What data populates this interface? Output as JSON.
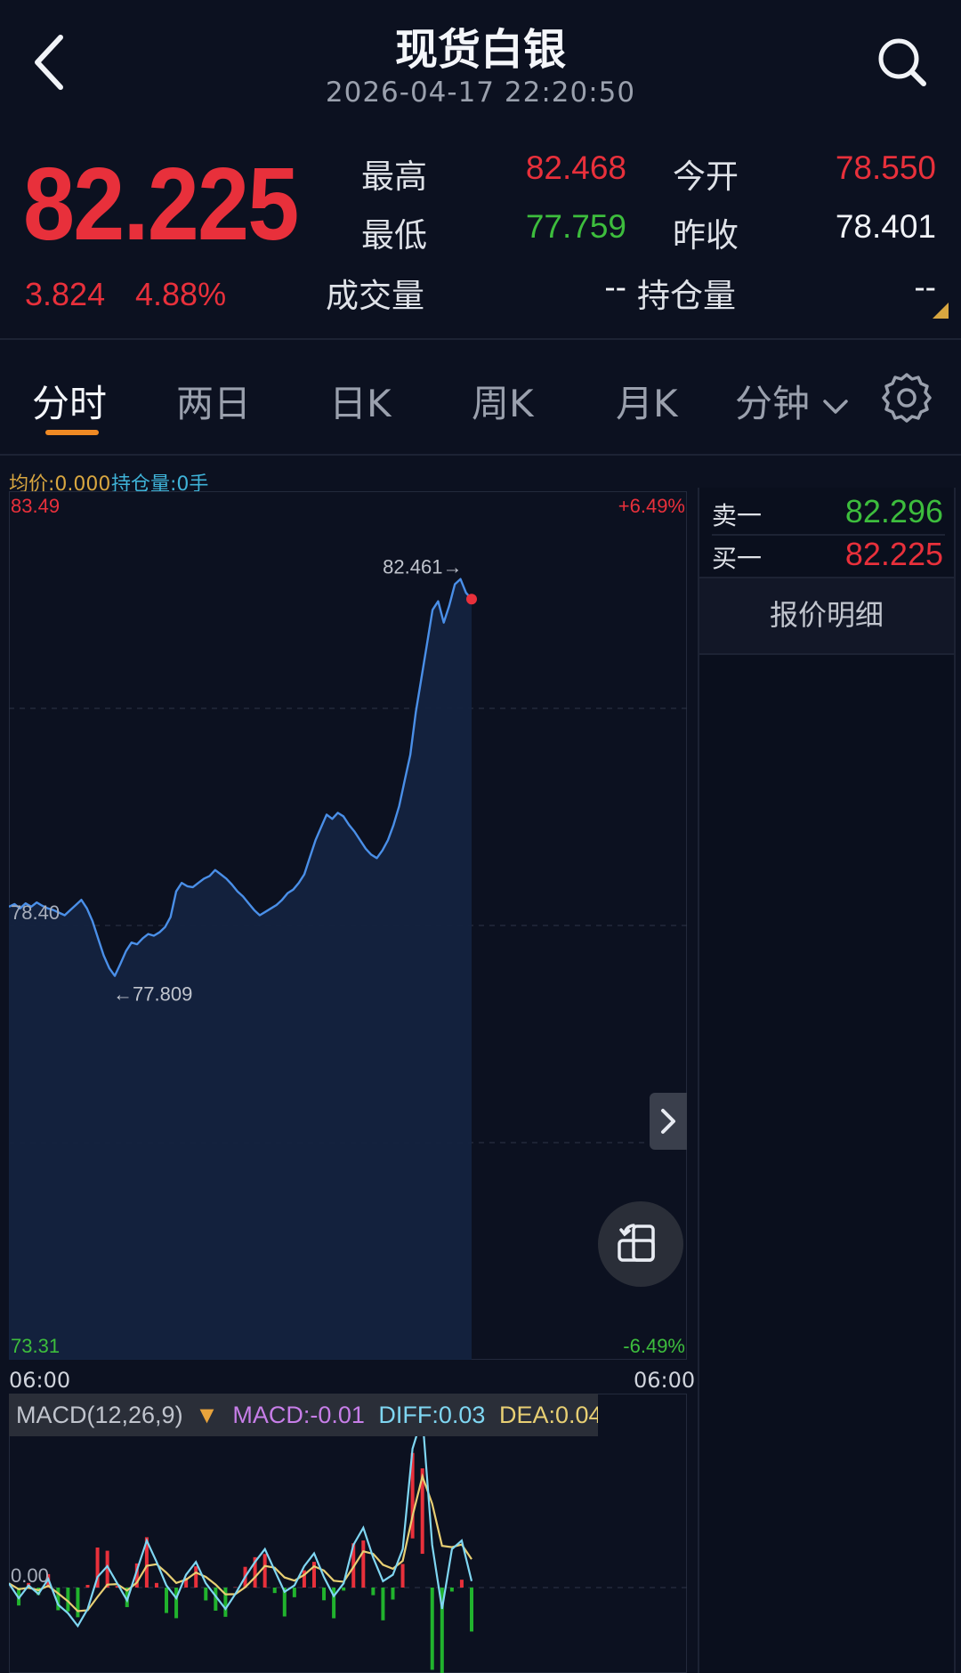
{
  "header": {
    "title": "现货白银",
    "datetime": "2026-04-17 22:20:50"
  },
  "quote": {
    "last": "82.225",
    "change": "3.824",
    "change_pct": "4.88%",
    "high_label": "最高",
    "high": "82.468",
    "low_label": "最低",
    "low": "77.759",
    "open_label": "今开",
    "open": "78.550",
    "prev_close_label": "昨收",
    "prev_close": "78.401",
    "volume_label": "成交量",
    "volume": "--",
    "open_interest_label": "持仓量",
    "open_interest": "--"
  },
  "tabs": {
    "items": [
      "分时",
      "两日",
      "日K",
      "周K",
      "月K",
      "分钟"
    ],
    "active": "分时"
  },
  "chart_legend": {
    "avg": "均价:0.000",
    "position": "持仓量:0手"
  },
  "chart_data": {
    "type": "line",
    "title": "",
    "ylim": [
      73.31,
      83.49
    ],
    "y_top_label": "83.49",
    "y_bottom_label": "73.31",
    "y_ref_label": "78.40",
    "pct_top_label": "+6.49%",
    "pct_bottom_label": "-6.49%",
    "x_start_label": "06:00",
    "x_end_label": "06:00",
    "max_annotation": "82.461→",
    "min_annotation": "←77.809",
    "series": [
      {
        "values": [
          78.62,
          78.65,
          78.6,
          78.66,
          78.62,
          78.67,
          78.63,
          78.6,
          78.58,
          78.55,
          78.52,
          78.58,
          78.64,
          78.7,
          78.6,
          78.45,
          78.25,
          78.05,
          77.9,
          77.81,
          77.95,
          78.1,
          78.2,
          78.18,
          78.25,
          78.3,
          78.28,
          78.32,
          78.38,
          78.5,
          78.8,
          78.9,
          78.86,
          78.85,
          78.9,
          78.95,
          78.98,
          79.05,
          79.0,
          78.95,
          78.88,
          78.8,
          78.74,
          78.66,
          78.58,
          78.52,
          78.56,
          78.6,
          78.64,
          78.7,
          78.78,
          78.82,
          78.9,
          79.0,
          79.2,
          79.4,
          79.55,
          79.7,
          79.65,
          79.72,
          79.68,
          79.58,
          79.5,
          79.4,
          79.3,
          79.23,
          79.19,
          79.28,
          79.4,
          79.58,
          79.8,
          80.1,
          80.4,
          80.9,
          81.3,
          81.7,
          82.1,
          82.2,
          81.95,
          82.15,
          82.4,
          82.461,
          82.3,
          82.225
        ]
      }
    ]
  },
  "order_book": {
    "ask_label": "卖一",
    "ask": "82.296",
    "bid_label": "买一",
    "bid": "82.225",
    "detail_tab": "报价明细"
  },
  "macd": {
    "name": "MACD(12,26,9)",
    "macd": "MACD:-0.01",
    "diff": "DIFF:0.03",
    "dea": "DEA:0.04",
    "zero_label": "0.00",
    "diff_values": [
      0.02,
      -0.05,
      0.01,
      -0.03,
      0.04,
      -0.08,
      -0.12,
      -0.18,
      -0.1,
      0.05,
      0.1,
      0.02,
      -0.06,
      0.08,
      0.22,
      0.12,
      0.01,
      -0.05,
      0.06,
      0.12,
      0.02,
      -0.04,
      -0.1,
      -0.03,
      0.05,
      0.12,
      0.18,
      0.08,
      -0.02,
      0.01,
      0.1,
      0.16,
      0.05,
      -0.04,
      0.02,
      0.2,
      0.28,
      0.14,
      0.03,
      0.06,
      0.18,
      0.65,
      0.8,
      0.2,
      -0.1,
      0.18,
      0.22,
      0.03
    ],
    "colors": {
      "diff": "#7fd6f2",
      "dea": "#e8cf73",
      "pos": "#e8303b",
      "neg": "#21b32d"
    }
  },
  "colors": {
    "up": "#e8303b",
    "down": "#3dbd3d",
    "line": "#4a8fe8",
    "accent": "#f08a24"
  }
}
